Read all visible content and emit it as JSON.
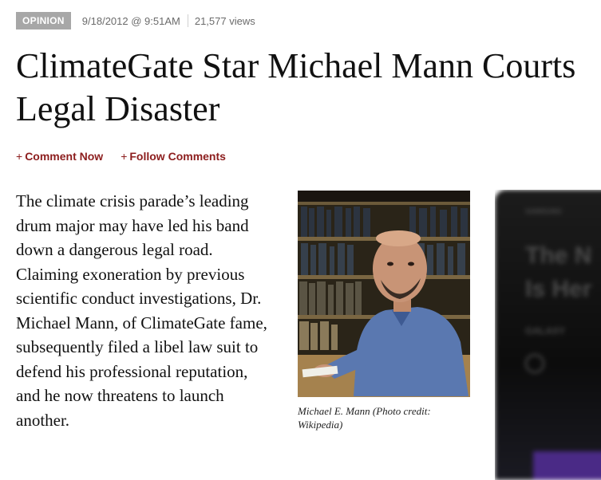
{
  "meta": {
    "badge": "OPINION",
    "date": "9/18/2012 @ 9:51AM",
    "views": "21,577 views"
  },
  "headline": "ClimateGate Star Michael Mann Courts Legal Disaster",
  "actions": {
    "comment_label": "Comment Now",
    "follow_label": "Follow Comments",
    "plus": "+"
  },
  "body": "The climate crisis parade’s leading drum major may have led his band down a dangerous legal road. Claiming exoneration by previous scientific conduct investigations, Dr. Michael Mann, of ClimateGate fame, subsequently filed a libel law suit to defend his professional reputation, and he now threatens to launch another.",
  "photo": {
    "caption": "Michael E. Mann (Photo credit: Wikipedia)"
  },
  "ad": {
    "brand": "SAMSUNG",
    "line1": "The N",
    "line2": "Is Her",
    "line3": "GALAXY"
  },
  "colors": {
    "badge_bg": "#a7a7a7",
    "action_red": "#8c1d1d"
  }
}
